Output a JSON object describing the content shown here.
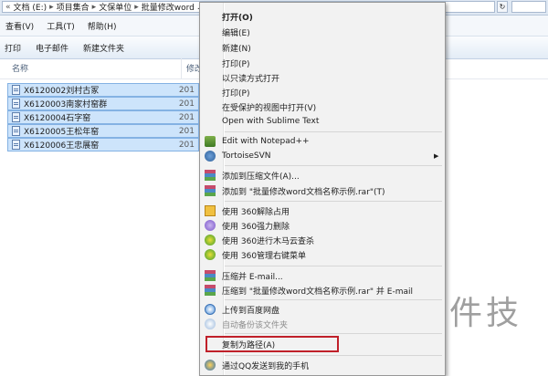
{
  "address": {
    "crumbs": [
      "文档 (E:)",
      "项目集合",
      "文保单位",
      "批量修改word"
    ],
    "cut_text": "...",
    "search_placeholder": ""
  },
  "menubar": {
    "items": [
      "查看(V)",
      "工具(T)",
      "帮助(H)"
    ]
  },
  "toolbar": {
    "items": [
      "打印",
      "电子邮件",
      "新建文件夹"
    ]
  },
  "file_list": {
    "columns": {
      "name": "名称",
      "modified": "修改"
    },
    "rows": [
      {
        "name": "X6120002刘村古冢",
        "date": "201"
      },
      {
        "name": "X6120003南家村窑群",
        "date": "201"
      },
      {
        "name": "X6120004石字窑",
        "date": "201"
      },
      {
        "name": "X6120005王松年窑",
        "date": "201"
      },
      {
        "name": "X6120006王忠展窑",
        "date": "201"
      }
    ]
  },
  "context_menu": {
    "open": "打开(O)",
    "edit": "编辑(E)",
    "new": "新建(N)",
    "print1": "打印(P)",
    "readonly": "以只读方式打开",
    "print2": "打印(P)",
    "protected_view": "在受保护的视图中打开(V)",
    "sublime": "Open with Sublime Text",
    "notepadpp": "Edit with Notepad++",
    "tortoise": "TortoiseSVN",
    "add_archive": "添加到压缩文件(A)...",
    "add_rar": "添加到 \"批量修改word文档名称示例.rar\"(T)",
    "unlock360": "使用 360解除占用",
    "delete360": "使用 360强力删除",
    "scan360": "使用 360进行木马云查杀",
    "manage360": "使用 360管理右键菜单",
    "zip_email": "压缩并 E-mail...",
    "zip_rar_email": "压缩到 \"批量修改word文档名称示例.rar\" 并 E-mail",
    "baidu_upload": "上传到百度网盘",
    "auto_backup": "自动备份该文件夹",
    "copy_path": "复制为路径(A)",
    "send_qq": "通过QQ发送到我的手机"
  },
  "watermark": "软件技"
}
